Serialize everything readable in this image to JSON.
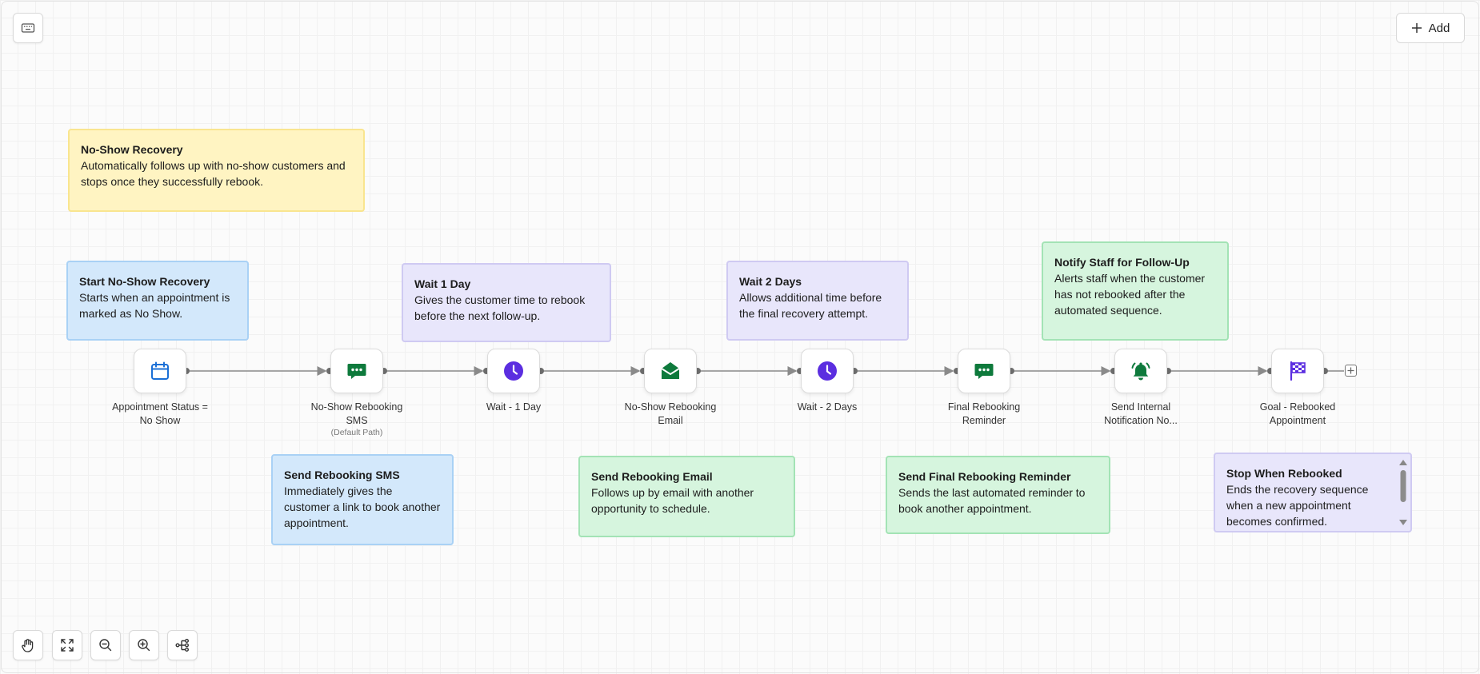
{
  "toolbar": {
    "add_label": "Add"
  },
  "notes": {
    "overview": {
      "title": "No-Show Recovery",
      "body": "Automatically follows up with no-show customers and stops once they successfully rebook."
    },
    "start": {
      "title": "Start No-Show Recovery",
      "body": "Starts when an appointment is marked as No Show."
    },
    "wait1": {
      "title": "Wait 1 Day",
      "body": "Gives the customer time to rebook before the next follow-up."
    },
    "wait2": {
      "title": "Wait 2 Days",
      "body": "Allows additional time before the final recovery attempt."
    },
    "notify": {
      "title": "Notify Staff for Follow-Up",
      "body": "Alerts staff when the customer has not rebooked after the automated sequence."
    },
    "sms": {
      "title": "Send Rebooking SMS",
      "body": "Immediately gives the customer a link to book another appointment."
    },
    "email": {
      "title": "Send Rebooking Email",
      "body": "Follows up by email with another opportunity to schedule."
    },
    "final": {
      "title": "Send Final Rebooking Reminder",
      "body": "Sends the last automated reminder to book another appointment."
    },
    "stop": {
      "title": "Stop When Rebooked",
      "body": "Ends the recovery sequence when a new appointment becomes confirmed."
    }
  },
  "nodes": [
    {
      "label": "Appointment Status = No Show",
      "icon": "calendar-icon"
    },
    {
      "label": "No-Show Rebooking SMS",
      "sublabel": "(Default Path)",
      "icon": "chat-icon"
    },
    {
      "label": "Wait - 1 Day",
      "icon": "clock-icon"
    },
    {
      "label": "No-Show Rebooking Email",
      "icon": "mail-open-icon"
    },
    {
      "label": "Wait - 2 Days",
      "icon": "clock-icon"
    },
    {
      "label": "Final Rebooking Reminder",
      "icon": "chat-icon"
    },
    {
      "label": "Send Internal Notification No...",
      "icon": "bell-icon"
    },
    {
      "label": "Goal - Rebooked Appointment",
      "icon": "flag-icon"
    }
  ],
  "colors": {
    "blue": "#1a6fd6",
    "green": "#0e7a3c",
    "purple": "#5b2ee0",
    "connector": "#8a8a8a"
  }
}
